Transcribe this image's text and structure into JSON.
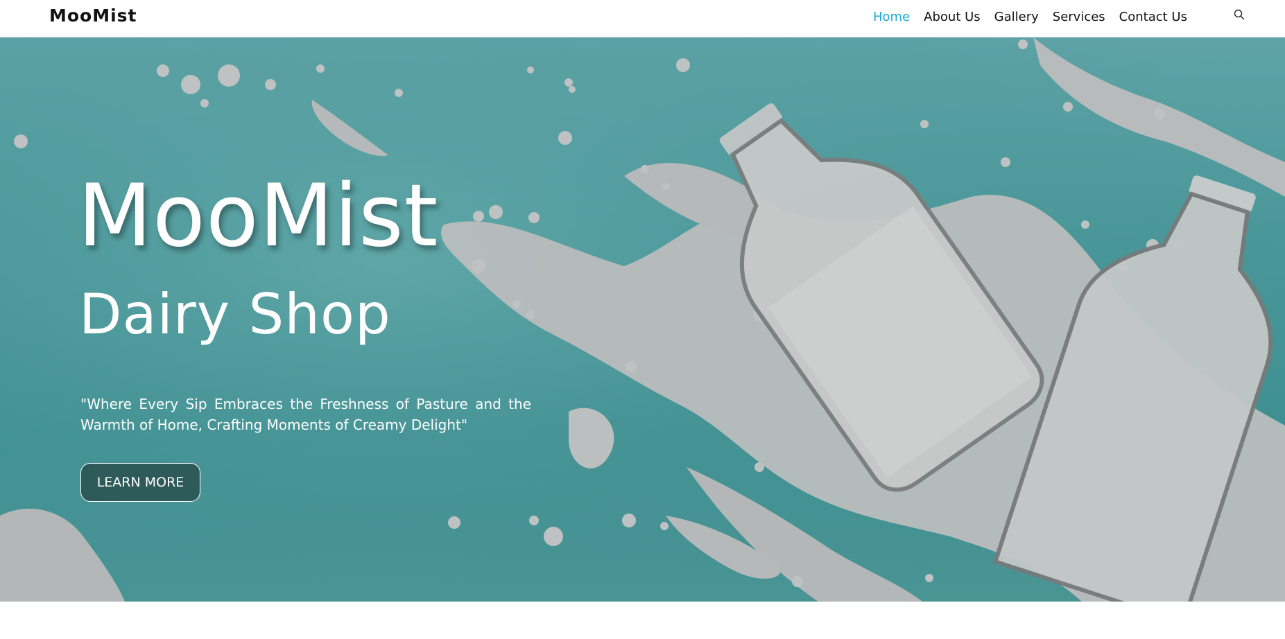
{
  "navbar": {
    "brand": "MooMist",
    "links": [
      {
        "label": "Home",
        "active": true
      },
      {
        "label": "About Us",
        "active": false
      },
      {
        "label": "Gallery",
        "active": false
      },
      {
        "label": "Services",
        "active": false
      },
      {
        "label": "Contact Us",
        "active": false
      }
    ],
    "search_icon": "search-icon",
    "active_color": "#17a9d6"
  },
  "hero": {
    "title": "MooMist",
    "subtitle": "Dairy Shop",
    "quote": "\"Where Every Sip Embraces the Freshness of Pasture and the Warmth of Home, Crafting Moments of Creamy Delight\"",
    "button_label": "LEARN MORE",
    "background_color": "#4a9799",
    "button_color": "#2f5a5a"
  }
}
